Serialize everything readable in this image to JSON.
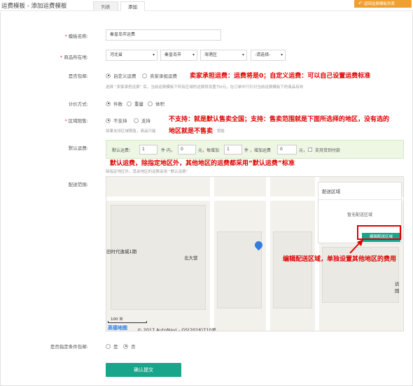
{
  "header": {
    "title": "运费模板 - 添加运费模板",
    "tabs": [
      {
        "label": "列表"
      },
      {
        "label": "添加"
      }
    ],
    "back_button": "返回运费模板列表"
  },
  "form": {
    "template_name": {
      "label": "模板名称:",
      "value": "秦皇岛市运费"
    },
    "location": {
      "label": "商品所在地:",
      "province": "河北省",
      "city": "秦皇岛市",
      "district": "海港区",
      "street": "-请选择-"
    },
    "free_shipping": {
      "label": "是否包邮:",
      "options": [
        "自定义运费",
        "卖家承担运费"
      ],
      "hint": "选择 “卖家承担运费” 后，当前运费模板下所有区域的运费将设置为0元，在订单中只针对当前运费模板下的商品有效"
    },
    "pricing": {
      "label": "计价方式:",
      "options": [
        "件数",
        "重量",
        "体积"
      ]
    },
    "region_limit": {
      "label": "区域限售:",
      "options": [
        "不支持",
        "支持"
      ],
      "hint_prefix": "如果支持区域限售，商品只能",
      "hint_suffix": "销售"
    },
    "default_freight": {
      "label": "默认运费:",
      "t1": "默认运费：",
      "v1": "1",
      "t2": "件 内，",
      "v2": "0",
      "t3": "元，每增加",
      "v3": "1",
      "t4": "件 ，增加运费",
      "v4": "0",
      "t5": "元，",
      "cod": "支持货到付款",
      "hint": "除指定地区外，其余地区的运费采用 “默认运费”"
    },
    "delivery_area": {
      "label": "配送范围:",
      "panel_title": "配送区域",
      "panel_empty": "暂无配送区域",
      "edit_button": "编辑配送区域"
    },
    "conditional_free": {
      "label": "是否指定条件包邮:",
      "options": [
        "是",
        "否"
      ]
    },
    "submit": "确认提交"
  },
  "map": {
    "labels": {
      "place1": "旧时代逸城1期",
      "place2": "北大营",
      "place3": "达园"
    },
    "scale": "100 米",
    "logo": "高德地图",
    "copyright": "© 2017 AutoNavi - GS(2016)710号"
  },
  "annotations": {
    "note1": "卖家承担运费：运费将是0；自定义运费：可以自己设置运费标准",
    "note2_line1": "不支持：就是默认售卖全国；支持：售卖范围就是下面所选择的地区，没有选的",
    "note2_line2": "地区就是不售卖",
    "note3": "默认运费，除指定地区外，其他地区的运费都采用“默认运费”标准",
    "note4": "编辑配送区域，单独设置其他地区的费用"
  },
  "colors": {
    "accent": "#19a589",
    "annotation": "#e00000",
    "back_button": "#f0a030"
  }
}
